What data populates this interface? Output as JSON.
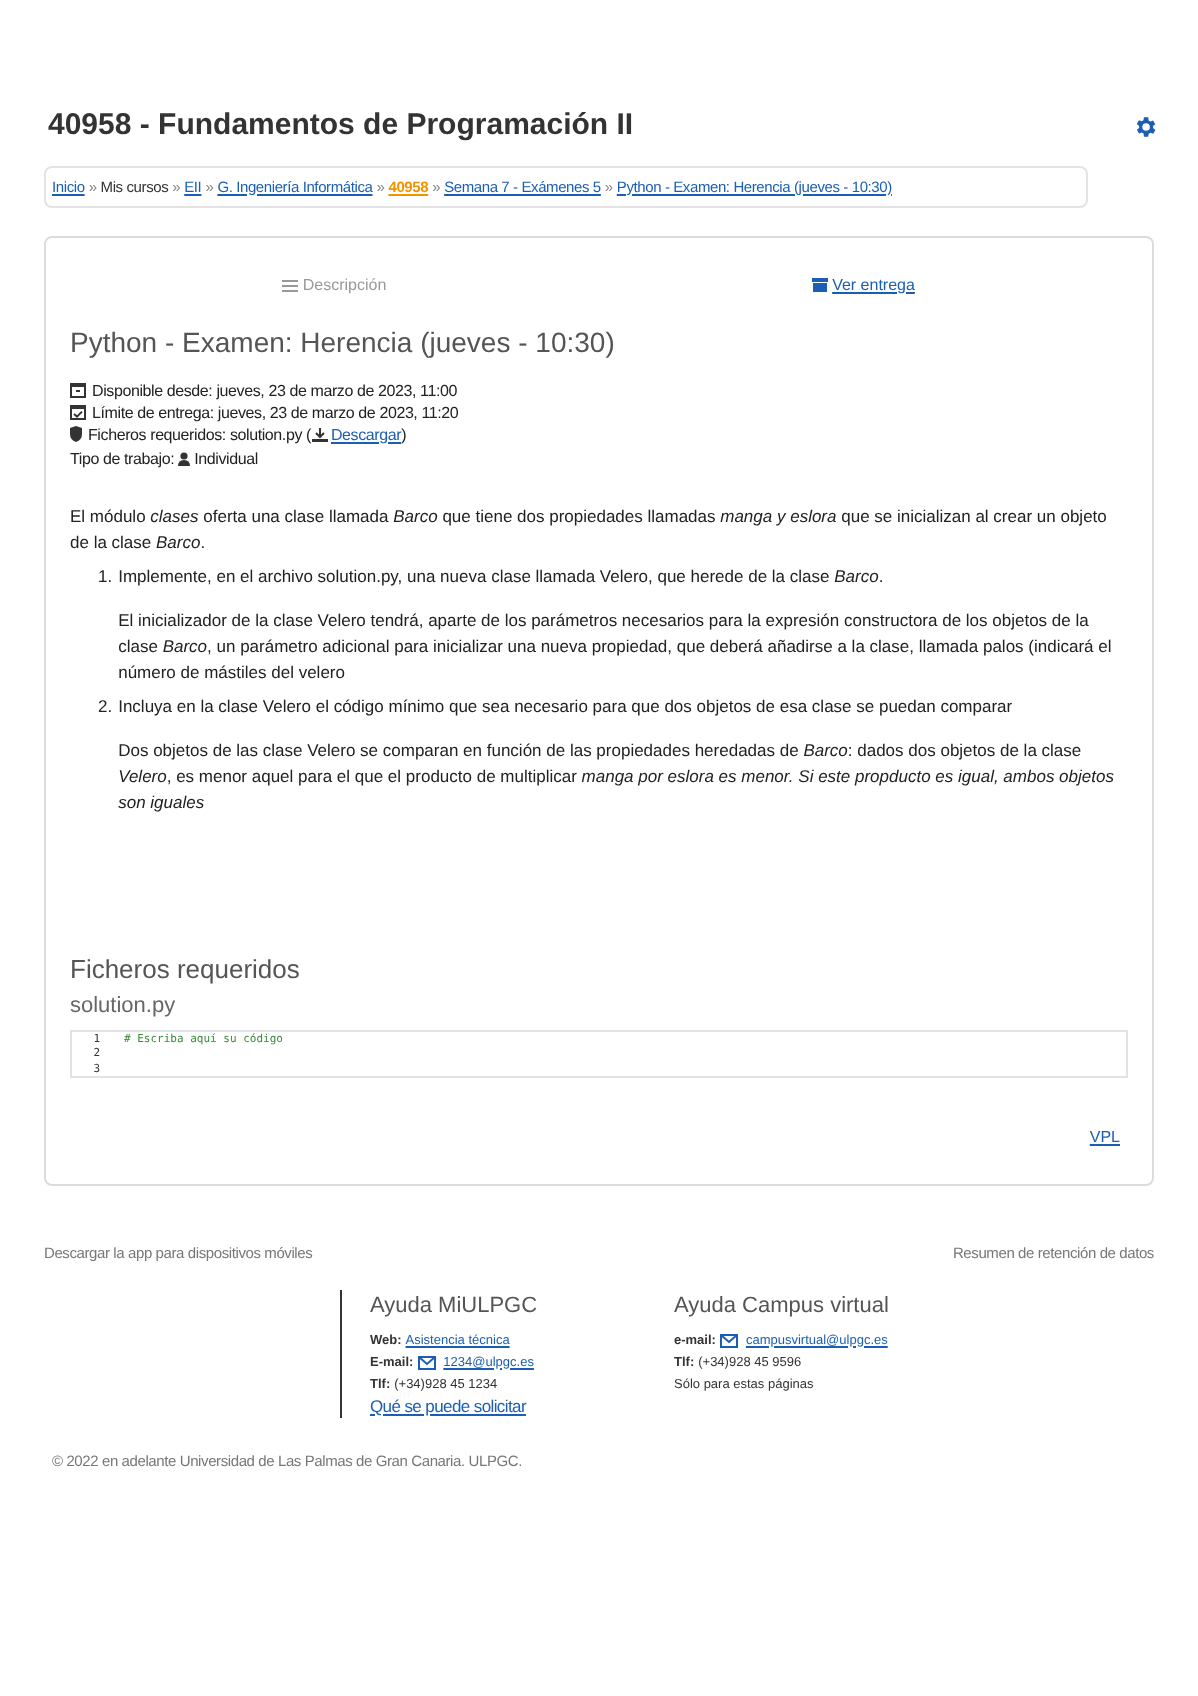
{
  "header": {
    "title": "40958 - Fundamentos de Programación II"
  },
  "breadcrumb": {
    "separator": "»",
    "items": [
      {
        "label": "Inicio",
        "kind": "link"
      },
      {
        "label": "Mis cursos",
        "kind": "text"
      },
      {
        "label": "EII",
        "kind": "link"
      },
      {
        "label": "G. Ingeniería Informática",
        "kind": "link"
      },
      {
        "label": "40958",
        "kind": "current"
      },
      {
        "label": "Semana 7 - Exámenes 5",
        "kind": "link"
      },
      {
        "label": "Python - Examen: Herencia (jueves - 10:30)",
        "kind": "link"
      }
    ]
  },
  "tabs": [
    {
      "label": "Descripción",
      "selected": true
    },
    {
      "label": "Ver entrega",
      "selected": false
    }
  ],
  "activity": {
    "title": "Python - Examen: Herencia (jueves - 10:30)",
    "details": [
      {
        "kind": "calendar",
        "text": "Disponible desde: jueves, 23 de marzo de 2023, 11:00"
      },
      {
        "kind": "calendar-check",
        "text": "Límite de entrega: jueves, 23 de marzo de 2023, 11:20"
      },
      {
        "kind": "shield",
        "text": "Ficheros requeridos: solution.py (",
        "link": "Descargar",
        "after": ")"
      },
      {
        "kind": "type",
        "text": "Tipo de trabajo:",
        "value": "Individual"
      }
    ],
    "intro": "El módulo *clases* oferta una clase llamada *Barco* que tiene dos propiedades llamadas *manga y eslora* que se inicializan al crear un objeto de la clase *Barco*.",
    "steps": [
      {
        "number": "1.",
        "text": "Implemente, en el archivo solution.py, una nueva clase llamada Velero, que herede de la clase *Barco*.",
        "detail": "El inicializador de la clase Velero tendrá, aparte de los parámetros necesarios para la expresión constructora de los objetos de la clase *Barco*, un parámetro adicional para inicializar una nueva propiedad, que deberá añadirse a la clase, llamada palos (indicará el número de mástiles del velero"
      },
      {
        "number": "2.",
        "text": "Incluya en la clase Velero el código mínimo que sea necesario para que dos objetos de esa clase se puedan comparar",
        "detail": "Dos objetos de las clase Velero se comparan en función de las propiedades heredadas de *Barco*: dados dos objetos de la clase *Velero*, es menor aquel para el que el producto de multiplicar *manga por eslora es menor. Si este propducto es igual, ambos objetos son iguales*"
      }
    ]
  },
  "files": {
    "heading": "Ficheros requeridos",
    "filename": "solution.py",
    "lines": [
      {
        "number": "1",
        "code": "# Escriba aquí su código"
      },
      {
        "number": "2"
      },
      {
        "number": "3"
      }
    ],
    "link": "VPL"
  },
  "footer": {
    "left": "Descargar la app para dispositivos móviles",
    "right": "Resumen de retención de datos",
    "help": [
      {
        "title": "Ayuda MiULPGC",
        "rows": [
          {
            "kind": "link",
            "label": "Web:",
            "value": "Asistencia técnica"
          },
          {
            "kind": "email",
            "label": "E-mail:",
            "value": "1234@ulpgc.es"
          },
          {
            "kind": "text",
            "label": "Tlf:",
            "value": "(+34)928 45 1234"
          }
        ],
        "more": "Qué se puede solicitar"
      },
      {
        "title": "Ayuda Campus virtual",
        "rows": [
          {
            "kind": "email",
            "label": "e-mail:",
            "value": "campusvirtual@ulpgc.es"
          },
          {
            "kind": "text",
            "label": "Tlf:",
            "value": "(+34)928 45 9596"
          },
          {
            "kind": "plain",
            "value": "Sólo para estas páginas"
          }
        ]
      }
    ],
    "copyright": "© 2022 en adelante Universidad de Las Palmas de Gran Canaria. ULPGC."
  }
}
